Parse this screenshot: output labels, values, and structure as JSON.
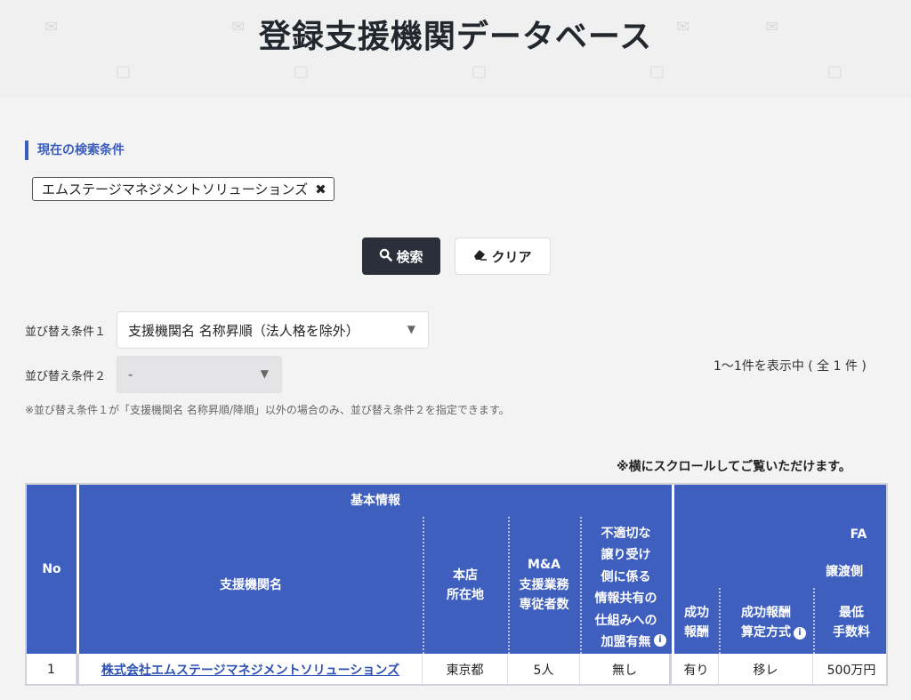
{
  "page": {
    "title": "登録支援機関データベース"
  },
  "search": {
    "condition_label": "現在の検索条件",
    "chip_text": "エムステージマネジメントソリューションズ",
    "search_label": "検索",
    "clear_label": "クリア"
  },
  "sort": {
    "label1": "並び替え条件１",
    "value1": "支援機関名 名称昇順（法人格を除外）",
    "label2": "並び替え条件２",
    "value2": "-",
    "note": "※並び替え条件１が「支援機関名 名称昇順/降順」以外の場合のみ、並び替え条件２を指定できます。"
  },
  "results": {
    "count_text": "1〜1件を表示中 ( 全 1 件 )",
    "scroll_note": "※横にスクロールしてご覧いただけます。"
  },
  "table": {
    "headers": {
      "no": "No",
      "basic_group": "基本情報",
      "name": "支援機関名",
      "hq": "本店\n所在地",
      "staff": "M&A\n支援業務\n専従者数",
      "info_share": "不適切な\n譲り受け\n側に係る\n情報共有の\n仕組みへの\n加盟有無",
      "fa_group": "FA",
      "transfer_group": "譲渡側",
      "success_fee": "成功\n報酬",
      "fee_method": "成功報酬\n算定方式",
      "min_fee": "最低\n手数料"
    },
    "rows": [
      {
        "no": "1",
        "name": "株式会社エムステージマネジメントソリューションズ",
        "hq": "東京都",
        "staff": "5人",
        "info_share": "無し",
        "success_fee": "有り",
        "fee_method": "移レ",
        "min_fee": "500万円"
      }
    ]
  },
  "colors": {
    "header_bg": "#3f5fbf",
    "accent": "#3a5dbd",
    "dark_button": "#2a2f3a"
  }
}
